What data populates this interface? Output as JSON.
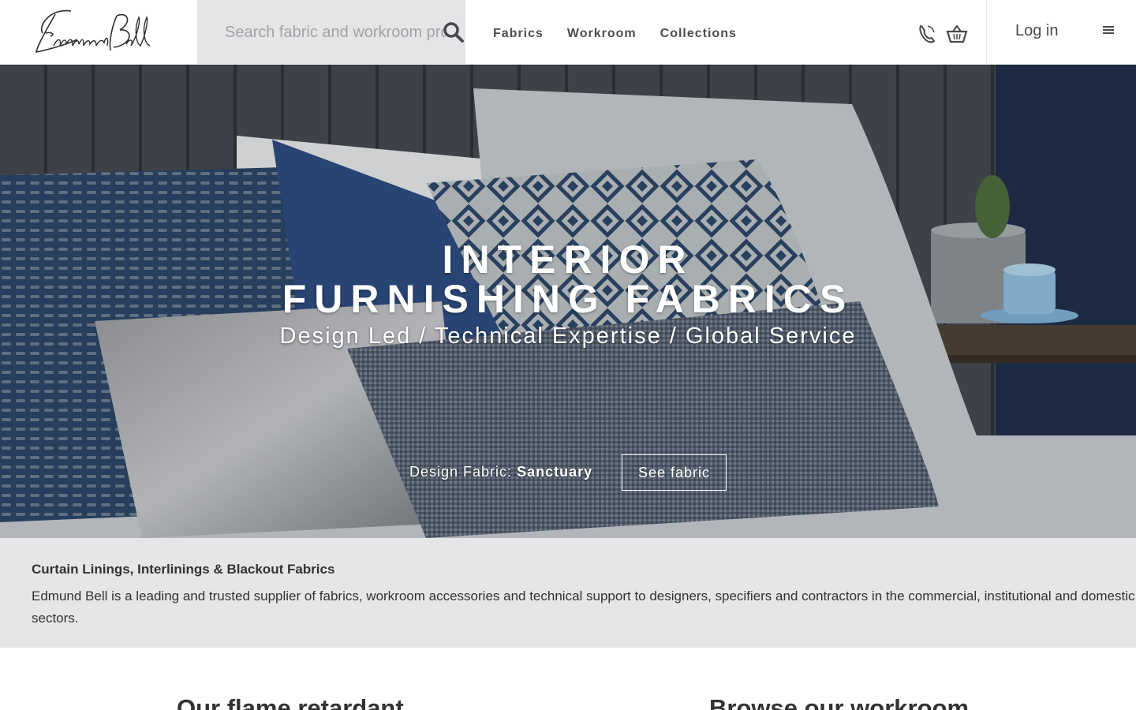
{
  "header": {
    "logo_text": "Edmund Bell",
    "search_placeholder": "Search fabric and workroom products",
    "nav": [
      {
        "label": "Fabrics"
      },
      {
        "label": "Workroom"
      },
      {
        "label": "Collections"
      }
    ],
    "login_label": "Log in",
    "icons": [
      "phone-icon",
      "basket-icon",
      "menu-icon",
      "search-icon"
    ]
  },
  "hero": {
    "title_line1": "INTERIOR",
    "title_line2": "FURNISHING FABRICS",
    "subtitle": "Design Led / Technical Expertise / Global Service",
    "fabric_prefix": "Design Fabric:",
    "fabric_name": "Sanctuary",
    "cta_label": "See fabric"
  },
  "info": {
    "title": "Curtain Linings, Interlinings & Blackout Fabrics",
    "text": "Edmund Bell is a leading and trusted supplier of fabrics, workroom accessories and technical support to designers, specifiers and contractors in the commercial, institutional and domestic sectors."
  },
  "bottom": {
    "left_heading": "Our flame retardant",
    "right_heading_prefix": "Browse our",
    "right_heading_bold": "workroom"
  },
  "colors": {
    "header_bg": "#ffffff",
    "search_bg": "#e5e5e7",
    "nav_text": "#4e4e52",
    "info_bg": "#e6e6e8",
    "hero_headboard": "#3e4047",
    "hero_accent_blue": "#2c4a75"
  }
}
